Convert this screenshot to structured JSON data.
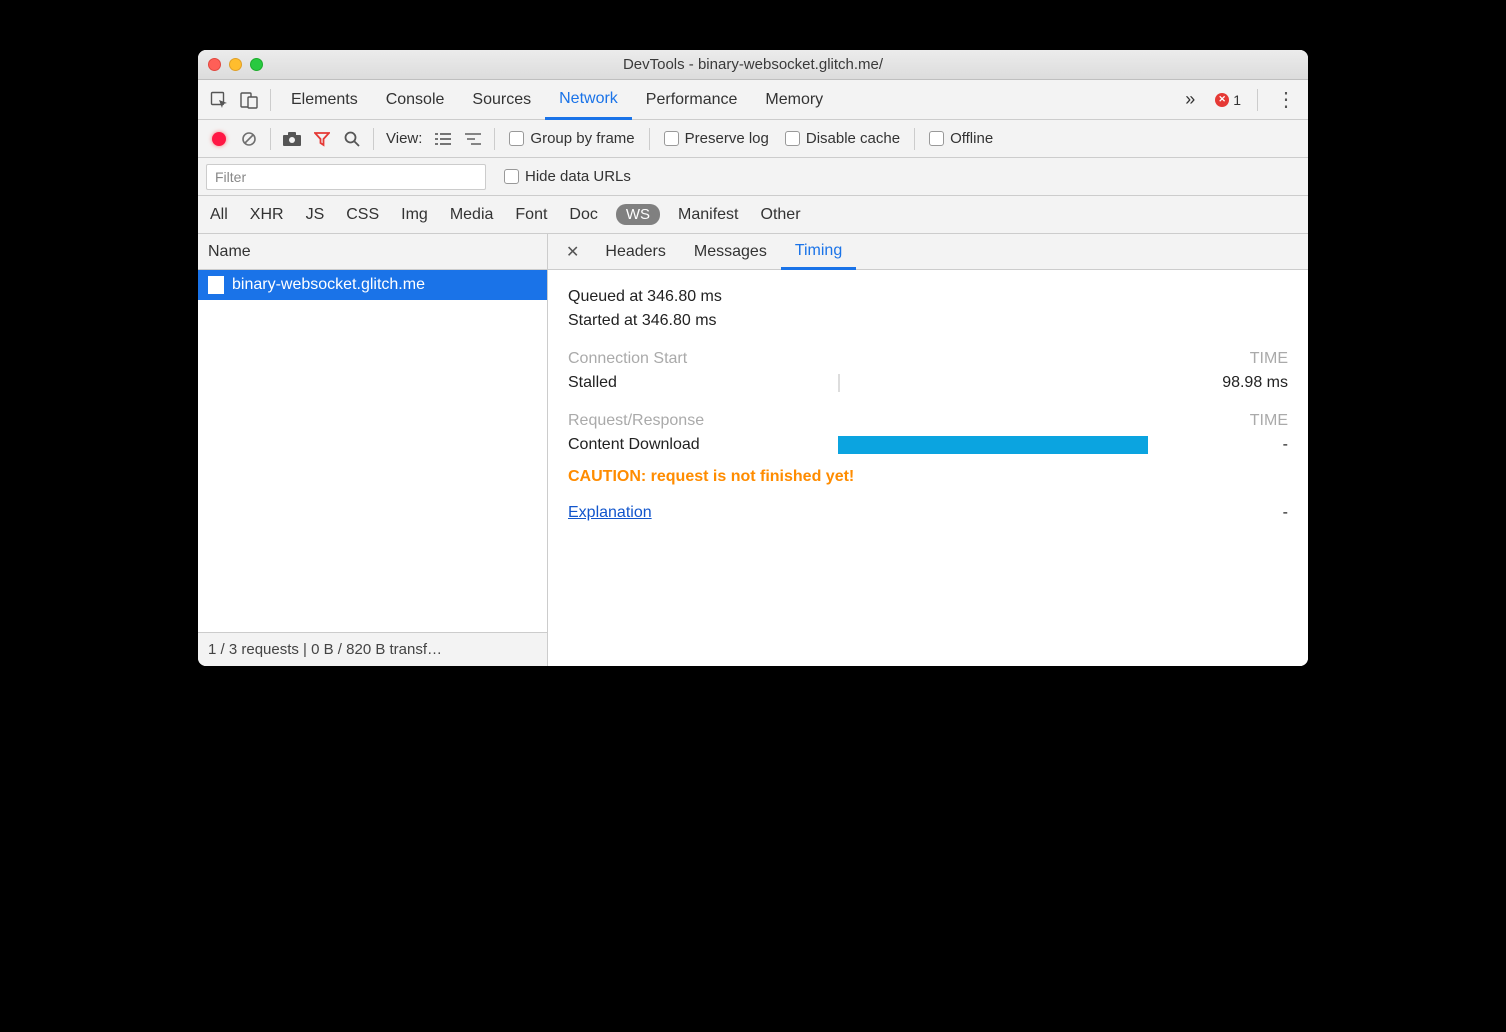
{
  "window": {
    "title": "DevTools - binary-websocket.glitch.me/"
  },
  "main_tabs": [
    "Elements",
    "Console",
    "Sources",
    "Network",
    "Performance",
    "Memory"
  ],
  "main_active": "Network",
  "errors": {
    "count": "1"
  },
  "toolbar": {
    "view_label": "View:",
    "group_by_frame": "Group by frame",
    "preserve_log": "Preserve log",
    "disable_cache": "Disable cache",
    "offline": "Offline"
  },
  "filter": {
    "placeholder": "Filter",
    "hide_data_urls": "Hide data URLs"
  },
  "types": [
    "All",
    "XHR",
    "JS",
    "CSS",
    "Img",
    "Media",
    "Font",
    "Doc",
    "WS",
    "Manifest",
    "Other"
  ],
  "types_active": "WS",
  "sidebar": {
    "name_header": "Name",
    "requests": [
      "binary-websocket.glitch.me"
    ],
    "status": "1 / 3 requests | 0 B / 820 B transf…"
  },
  "detail": {
    "tabs": [
      "Headers",
      "Messages",
      "Timing"
    ],
    "active": "Timing",
    "queued": "Queued at 346.80 ms",
    "started": "Started at 346.80 ms",
    "conn_start_hdr": "Connection Start",
    "time_hdr": "TIME",
    "stalled_label": "Stalled",
    "stalled_val": "98.98 ms",
    "req_resp_hdr": "Request/Response",
    "content_dl_label": "Content Download",
    "content_dl_val": "-",
    "caution": "CAUTION: request is not finished yet!",
    "explanation": "Explanation",
    "explanation_val": "-"
  }
}
